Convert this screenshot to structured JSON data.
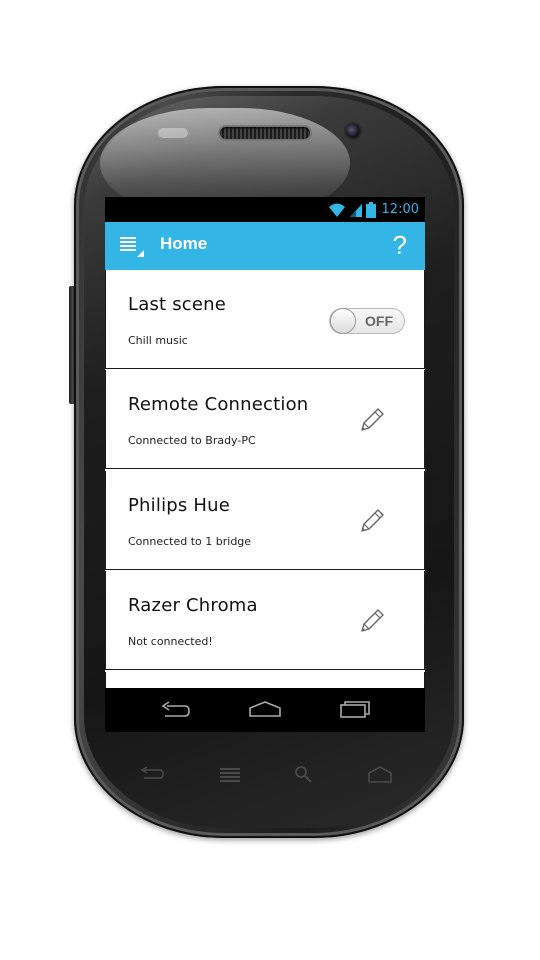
{
  "status_bar": {
    "time": "12:00",
    "icons": [
      "wifi-icon",
      "signal-icon",
      "battery-icon"
    ],
    "color": "#33b5e5"
  },
  "action_bar": {
    "title": "Home",
    "help_label": "?",
    "background": "#33b5e5"
  },
  "cards": [
    {
      "title": "Last scene",
      "subtitle": "Chill music",
      "control": "toggle",
      "toggle_label": "OFF",
      "toggle_on": false
    },
    {
      "title": "Remote Connection",
      "subtitle": "Connected to Brady-PC",
      "control": "edit-icon"
    },
    {
      "title": "Philips Hue",
      "subtitle": "Connected to 1 bridge",
      "control": "edit-icon"
    },
    {
      "title": "Razer Chroma",
      "subtitle": "Not connected!",
      "control": "edit-icon"
    }
  ],
  "nav_bar": {
    "buttons": [
      "back-icon",
      "home-icon",
      "recent-apps-icon"
    ]
  },
  "hardware_buttons": [
    "back-icon",
    "menu-icon",
    "search-icon",
    "home-icon"
  ]
}
